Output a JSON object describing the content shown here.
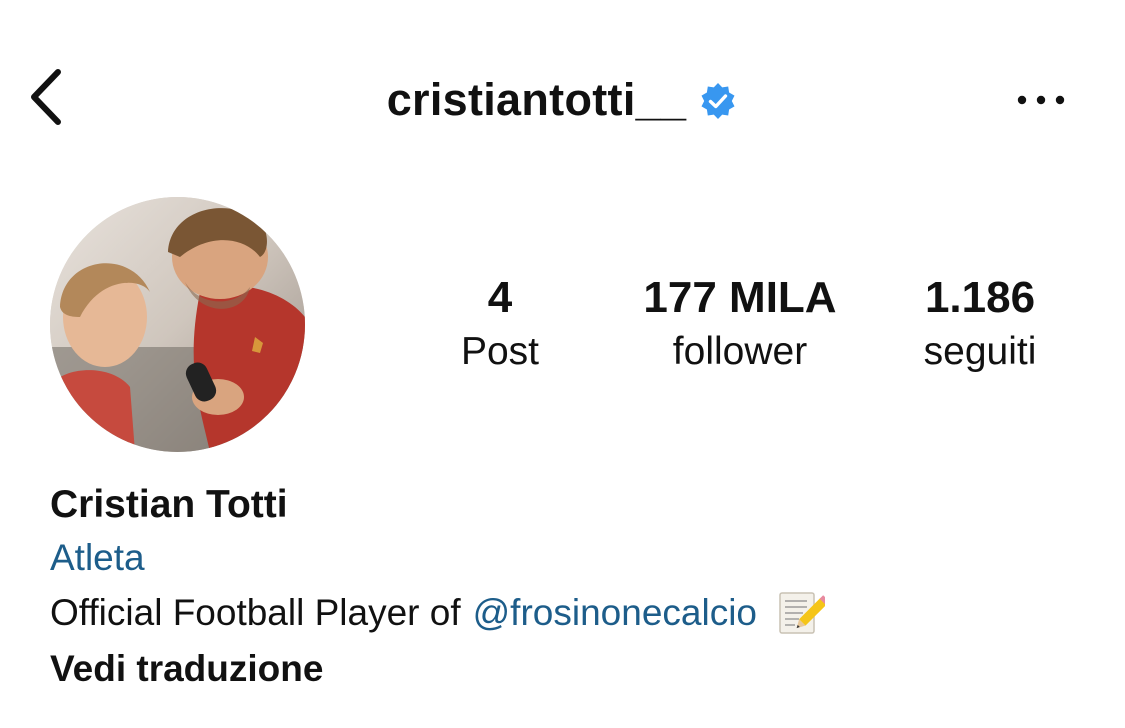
{
  "header": {
    "username": "cristiantotti__",
    "verified": true,
    "back_icon": "chevron-left-icon",
    "more_icon": "more-horizontal-icon"
  },
  "profile": {
    "avatar_icon": "profile-photo",
    "stats": [
      {
        "value": "4",
        "label": "Post"
      },
      {
        "value": "177 MILA",
        "label": "follower"
      },
      {
        "value": "1.186",
        "label": "seguiti"
      }
    ]
  },
  "bio": {
    "name": "Cristian Totti",
    "category": "Atleta",
    "text": "Official Football Player of",
    "mention": "@frosinonecalcio",
    "emoji_icon": "memo-emoji",
    "translate_label": "Vedi traduzione"
  },
  "colors": {
    "link": "#1d5d8a",
    "verified_badge": "#3897f0",
    "text": "#111111"
  }
}
